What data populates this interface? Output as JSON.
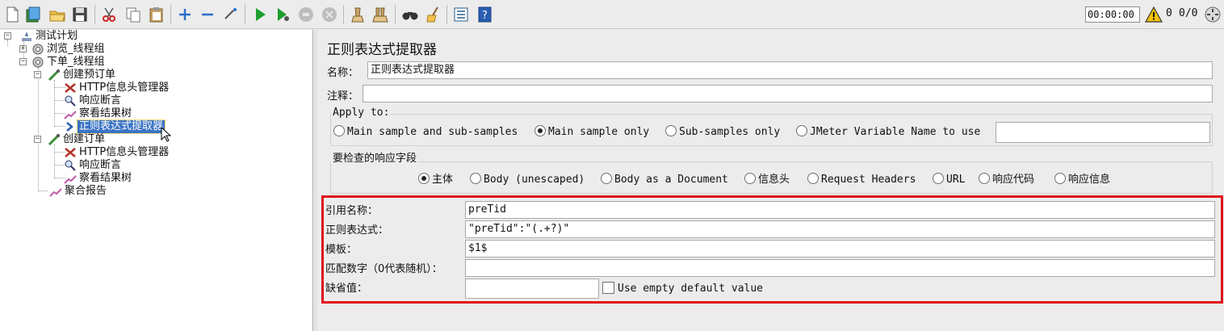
{
  "toolbar": {
    "icons": [
      "new-icon",
      "templates-icon",
      "open-icon",
      "save-icon",
      "cut-icon",
      "copy-icon",
      "paste-icon",
      "expand-icon",
      "collapse-icon",
      "toggle-icon",
      "start-icon",
      "start-no-pauses-icon",
      "stop-icon",
      "shutdown-icon",
      "clear-icon",
      "clear-all-icon",
      "search-icon",
      "reset-search-icon",
      "function-helper-icon",
      "help-icon"
    ],
    "timer": "00:00:00",
    "warnings": "0",
    "threads": "0/0"
  },
  "tree": {
    "items": [
      {
        "label": "测试计划",
        "icon": "test-plan-icon"
      },
      {
        "label": "浏览_线程组",
        "icon": "thread-group-icon"
      },
      {
        "label": "下单_线程组",
        "icon": "thread-group-icon"
      },
      {
        "label": "创建预订单",
        "icon": "sampler-icon"
      },
      {
        "label": "HTTP信息头管理器",
        "icon": "config-tools-icon"
      },
      {
        "label": "响应断言",
        "icon": "assertion-icon"
      },
      {
        "label": "察看结果树",
        "icon": "listener-icon"
      },
      {
        "label": "正则表达式提取器",
        "icon": "post-processor-icon"
      },
      {
        "label": "创建订单",
        "icon": "sampler-icon"
      },
      {
        "label": "HTTP信息头管理器",
        "icon": "config-tools-icon"
      },
      {
        "label": "响应断言",
        "icon": "assertion-icon"
      },
      {
        "label": "察看结果树",
        "icon": "listener-icon"
      },
      {
        "label": "聚合报告",
        "icon": "listener-icon"
      }
    ]
  },
  "panel": {
    "title": "正则表达式提取器",
    "name_label": "名称：",
    "name_value": "正则表达式提取器",
    "comment_label": "注释：",
    "comment_value": "",
    "apply_to": {
      "title": "Apply to:",
      "options": [
        "Main sample and sub-samples",
        "Main sample only",
        "Sub-samples only",
        "JMeter Variable Name to use"
      ],
      "selected": "Main sample only",
      "variable_name_value": ""
    },
    "field_to_check": {
      "title": "要检查的响应字段",
      "options": [
        "主体",
        "Body (unescaped)",
        "Body as a Document",
        "信息头",
        "Request Headers",
        "URL",
        "响应代码",
        "响应信息"
      ],
      "selected": "主体"
    },
    "reference_name_label": "引用名称：",
    "reference_name_value": "preTid",
    "regex_label": "正则表达式：",
    "regex_value": "\"preTid\":\"(.+?)\"",
    "template_label": "模板：",
    "template_value": "$1$",
    "match_no_label": "匹配数字（0代表随机）：",
    "match_no_value": "",
    "default_label": "缺省值：",
    "default_value": "",
    "use_empty_default_label": "Use empty default value",
    "use_empty_default_checked": false,
    "highlight_color": "#e0111c"
  }
}
